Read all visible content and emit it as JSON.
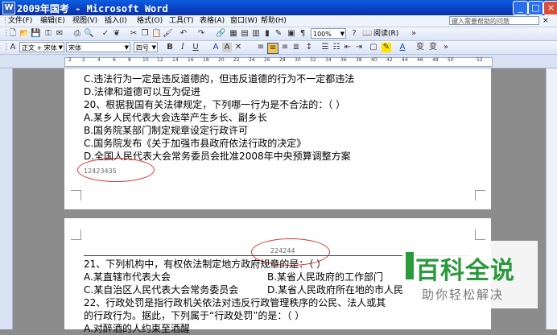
{
  "window": {
    "title": "2009年国考 - Microsoft Word",
    "app_icon": "W",
    "controls": {
      "minimize": "_",
      "maximize": "□",
      "close": "×"
    }
  },
  "menu": {
    "items": [
      "文件(F)",
      "编辑(E)",
      "视图(V)",
      "插入(I)",
      "格式(O)",
      "工具(T)",
      "表格(A)",
      "窗口(W)",
      "帮助(H)"
    ],
    "help_placeholder": "键入需要帮助的问题"
  },
  "toolbar": {
    "zoom": "100%",
    "read_label": "阅读(R)"
  },
  "format_bar": {
    "style": "正文 + 宋体",
    "font": "宋体",
    "size": "四号",
    "bold": "B",
    "italic": "I",
    "underline": "U",
    "font_color": "A",
    "highlight": "A",
    "char_spacing": "变",
    "char_shade": "变"
  },
  "ruler": {
    "ticks": [
      "2",
      "",
      "2",
      "4",
      "6",
      "8",
      "10",
      "12",
      "14",
      "16",
      "18",
      "20",
      "22",
      "24",
      "26",
      "28",
      "30",
      "32",
      "34",
      "36",
      "38",
      "40",
      "42",
      "44",
      "46",
      "48",
      "50",
      "52"
    ]
  },
  "page1": {
    "lines": [
      "C.违法行为一定是违反道德的，但违反道德的行为不一定都违法",
      "D.法律和道德可以互为促进",
      "20、根据我国有关法律规定，下列哪一行为是不合法的：（    ）",
      "A.某乡人民代表大会选举产生乡长、副乡长",
      "B.国务院某部门制定规章设定行政许可",
      "C.国务院发布《关于加强市县政府依法行政的决定》",
      "D.全国人民代表大会常务委员会批准2008年中央预算调整方案"
    ],
    "footer_number": "12423435"
  },
  "page2": {
    "header_number": "224244",
    "lines": [
      "21、下列机构中，有权依法制定地方政府规章的是：（    ）",
      "A.某直辖市代表大会",
      "B.某省人民政府的工作部门",
      "C.某自治区人民代表大会常务委员会",
      "D.某省人民政府所在地的市人民",
      "22、行政处罚是指行政机关依法对违反行政管理秩序的公民、法人或其",
      "的行政行为。据此，下列属于“行政处罚”的是：（    ）",
      "A.对醉酒的人约束至酒醒"
    ]
  },
  "watermark": {
    "title": "百科全说",
    "subtitle": "助你轻松解决"
  }
}
